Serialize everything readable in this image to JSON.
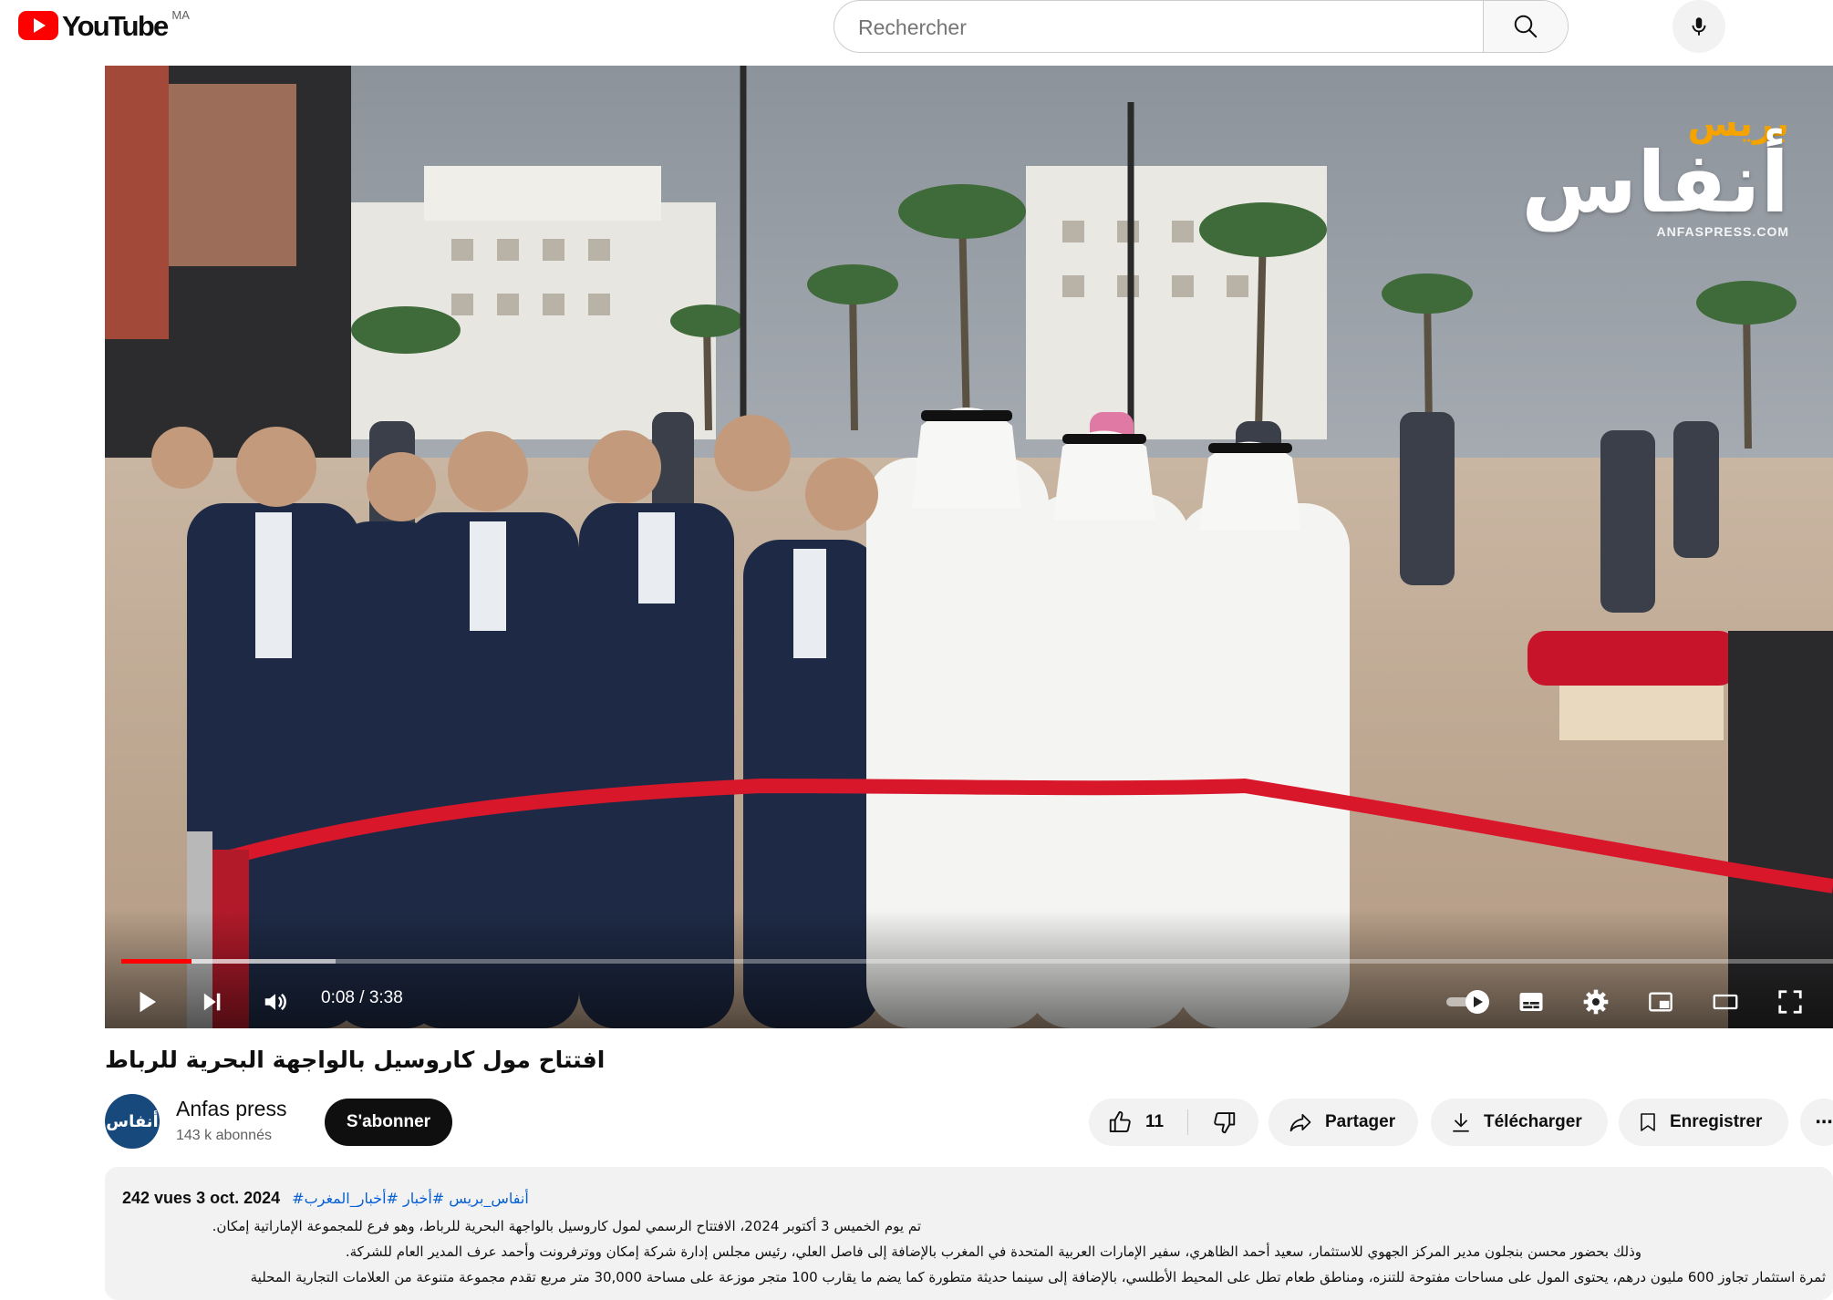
{
  "masthead": {
    "logo_text": "YouTube",
    "country_code": "MA",
    "search_placeholder": "Rechercher",
    "search_icon": "search-icon",
    "mic_icon": "microphone-icon"
  },
  "player": {
    "watermark": {
      "small": "بريس",
      "big": "أنفاس",
      "url": "ANFASPRESS.COM"
    },
    "time": "0:08 / 3:38",
    "progress_fraction": 0.041,
    "buffered_fraction": 0.125,
    "controls": [
      "play-icon",
      "next-icon",
      "volume-icon",
      "autoplay-toggle",
      "subtitles-icon",
      "settings-icon",
      "miniplayer-icon",
      "theater-icon",
      "fullscreen-icon"
    ]
  },
  "video": {
    "title": "افتتاح مول كاروسيل بالواجهة البحرية للرباط",
    "channel_name": "Anfas press",
    "channel_avatar_text": "أنفاس",
    "subscribers": "143 k abonnés",
    "subscribe_label": "S'abonner",
    "likes": "11",
    "share_label": "Partager",
    "download_label": "Télécharger",
    "save_label": "Enregistrer",
    "more_label": "⋯"
  },
  "description": {
    "views": "242 vues",
    "date": "3 oct. 2024",
    "hashtags": "#أنفاس_بريس #أخبار #أخبار_المغرب",
    "lines": [
      "تم يوم الخميس 3 أكتوبر 2024، الافتتاح الرسمي لمول كاروسيل بالواجهة البحرية للرباط، وهو فرع للمجموعة الإماراتية إمكان.",
      "وذلك بحضور محسن  بنجلون مدير المركز الجهوي للاستثمار، سعيد أحمد الظاهري، سفير  الإمارات العربية المتحدة في المغرب بالإضافة إلى  فاصل العلي، رئيس مجلس إدارة شركة إمكان ووترفرونت  وأحمد عرف المدير العام للشركة.",
      "ثمرة استثمار تجاوز 600 مليون درهم، يحتوى المول على مساحات مفتوحة للتنزه، ومناطق طعام تطل على المحيط الأطلسي، بالإضافة إلى سينما حديثة متطورة كما يضم ما يقارب 100 متجر موزعة على مساحة 30,000 متر مربع تقدم مجموعة متنوعة من العلامات التجارية المحلية"
    ]
  },
  "colors": {
    "brand_red": "#ff0000",
    "ribbon_red": "#d8172b",
    "link_blue": "#065fd4",
    "subscribe_bg": "#0f0f0f",
    "pill_bg": "#f2f2f2"
  }
}
